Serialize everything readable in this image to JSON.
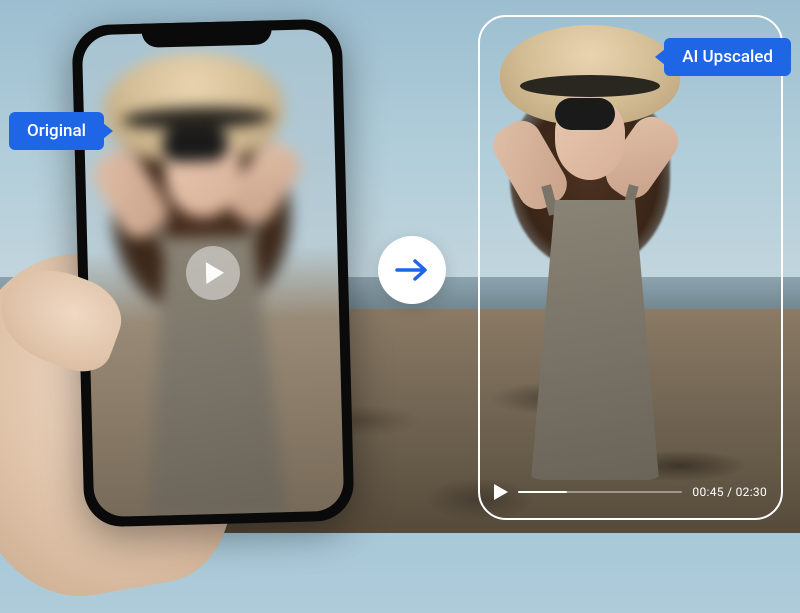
{
  "badges": {
    "original": "Original",
    "upscaled": "AI Upscaled"
  },
  "video": {
    "current_time": "00:45",
    "total_time": "02:30",
    "separator": " / ",
    "progress_percent": 30
  },
  "colors": {
    "accent": "#1e66e6",
    "frame": "#ffffff"
  },
  "icons": {
    "play_large": "play-icon",
    "play_small": "play-icon",
    "arrow_right": "arrow-right-icon"
  }
}
